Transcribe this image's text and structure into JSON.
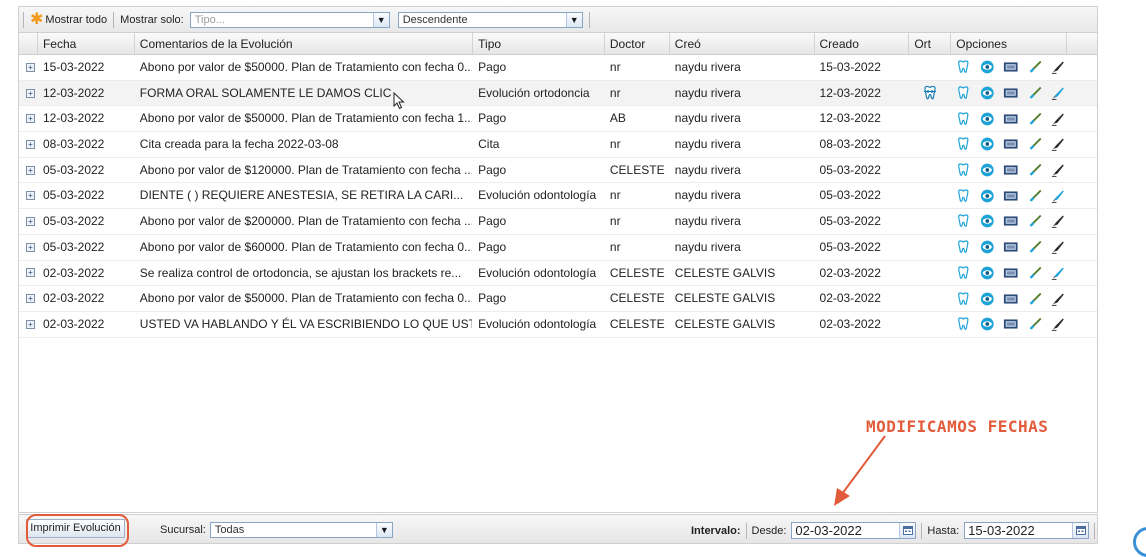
{
  "toolbar": {
    "show_all_label": "Mostrar todo",
    "show_only_label": "Mostrar solo:",
    "type_placeholder": "Tipo...",
    "order_value": "Descendente"
  },
  "columns": [
    "Fecha",
    "Comentarios de la Evolución",
    "Tipo",
    "Doctor",
    "Creó",
    "Creado",
    "Ort",
    "Opciones"
  ],
  "rows": [
    {
      "fecha": "15-03-2022",
      "comentario": "Abono por valor de $50000. Plan de Tratamiento con fecha 0...",
      "tipo": "Pago",
      "doctor": "nr",
      "creo": "naydu rivera",
      "creado": "15-03-2022",
      "ort": false
    },
    {
      "fecha": "12-03-2022",
      "comentario": "FORMA ORAL SOLAMENTE LE DAMOS CLIC",
      "tipo": "Evolución ortodoncia",
      "doctor": "nr",
      "creo": "naydu rivera",
      "creado": "12-03-2022",
      "ort": true
    },
    {
      "fecha": "12-03-2022",
      "comentario": "Abono por valor de $50000. Plan de Tratamiento con fecha 1...",
      "tipo": "Pago",
      "doctor": "AB",
      "creo": "naydu rivera",
      "creado": "12-03-2022",
      "ort": false
    },
    {
      "fecha": "08-03-2022",
      "comentario": "Cita creada para la fecha 2022-03-08",
      "tipo": "Cita",
      "doctor": "nr",
      "creo": "naydu rivera",
      "creado": "08-03-2022",
      "ort": false
    },
    {
      "fecha": "05-03-2022",
      "comentario": "Abono por valor de $120000. Plan de Tratamiento con fecha ...",
      "tipo": "Pago",
      "doctor": "CELESTE",
      "creo": "naydu rivera",
      "creado": "05-03-2022",
      "ort": false
    },
    {
      "fecha": "05-03-2022",
      "comentario": "DIENTE ( ) REQUIERE ANESTESIA, SE RETIRA LA CARI...",
      "tipo": "Evolución odontología",
      "doctor": "nr",
      "creo": "naydu rivera",
      "creado": "05-03-2022",
      "ort": false
    },
    {
      "fecha": "05-03-2022",
      "comentario": "Abono por valor de $200000. Plan de Tratamiento con fecha ...",
      "tipo": "Pago",
      "doctor": "nr",
      "creo": "naydu rivera",
      "creado": "05-03-2022",
      "ort": false
    },
    {
      "fecha": "05-03-2022",
      "comentario": "Abono por valor de $60000. Plan de Tratamiento con fecha 0...",
      "tipo": "Pago",
      "doctor": "nr",
      "creo": "naydu rivera",
      "creado": "05-03-2022",
      "ort": false
    },
    {
      "fecha": "02-03-2022",
      "comentario": "Se realiza control de ortodoncia, se ajustan los brackets re...",
      "tipo": "Evolución odontología",
      "doctor": "CELESTE",
      "creo": "CELESTE GALVIS",
      "creado": "02-03-2022",
      "ort": false
    },
    {
      "fecha": "02-03-2022",
      "comentario": "Abono por valor de $50000. Plan de Tratamiento con fecha 0...",
      "tipo": "Pago",
      "doctor": "CELESTE",
      "creo": "CELESTE GALVIS",
      "creado": "02-03-2022",
      "ort": false
    },
    {
      "fecha": "02-03-2022",
      "comentario": "USTED VA HABLANDO Y ÉL VA ESCRIBIENDO LO QUE USTE...",
      "tipo": "Evolución odontología",
      "doctor": "CELESTE",
      "creo": "CELESTE GALVIS",
      "creado": "02-03-2022",
      "ort": false
    }
  ],
  "bottom": {
    "print_label": "Imprimir Evolución",
    "sucursal_label": "Sucursal:",
    "sucursal_value": "Todas",
    "interval_label": "Intervalo:",
    "desde_label": "Desde:",
    "desde_value": "02-03-2022",
    "hasta_label": "Hasta:",
    "hasta_value": "15-03-2022"
  },
  "annotation": {
    "text": "MODIFICAMOS FECHAS",
    "color": "#e25b3a"
  },
  "icons": [
    "tooth-icon",
    "eye-icon",
    "print-icon",
    "brush-icon",
    "pen-icon"
  ],
  "colors": {
    "accent": "#e25b3a",
    "icon_blue": "#1ea3d8",
    "row_alt": "#f3f3f3"
  }
}
